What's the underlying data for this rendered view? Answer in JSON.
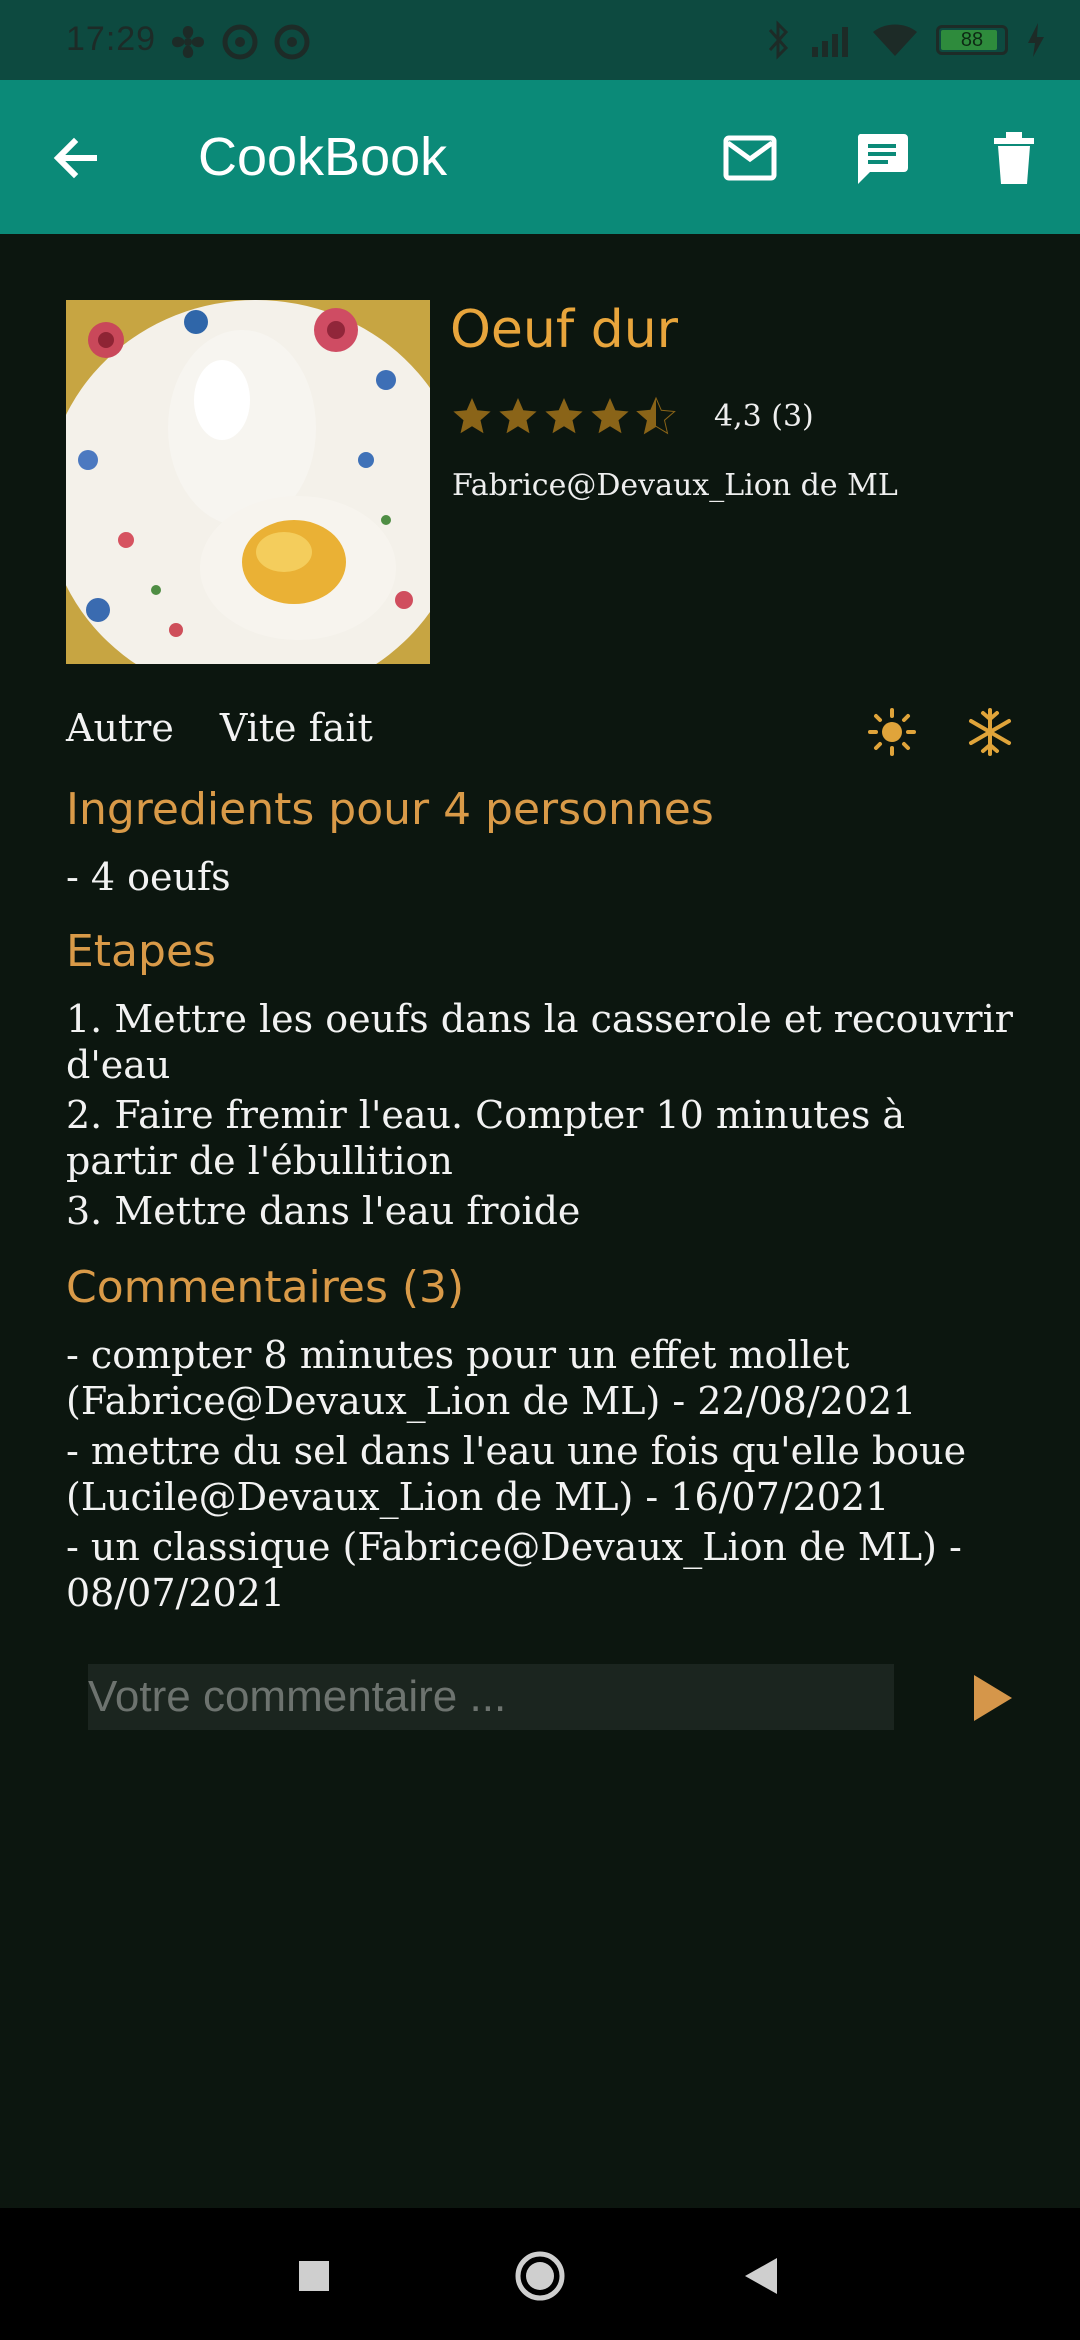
{
  "status_bar": {
    "time": "17:29",
    "battery": "88",
    "icons_left": [
      "fan-icon",
      "at-icon",
      "at-icon"
    ],
    "icons_right": [
      "bluetooth-icon",
      "signal-icon",
      "wifi-icon",
      "battery-icon",
      "charging-icon"
    ]
  },
  "app_bar": {
    "title": "CookBook",
    "actions": [
      "mail-icon",
      "message-icon",
      "delete-icon"
    ]
  },
  "recipe": {
    "title": "Oeuf dur",
    "rating_value": 4.3,
    "rating_text": "4,3  (3)",
    "author": "Fabrice@Devaux_Lion de ML",
    "tags": [
      "Autre",
      "Vite fait"
    ],
    "season_icons": [
      "sun-icon",
      "snowflake-icon"
    ]
  },
  "ingredients": {
    "title": "Ingredients pour 4 personnes",
    "items": [
      "- 4 oeufs"
    ]
  },
  "steps": {
    "title": "Etapes",
    "items": [
      "1. Mettre les oeufs dans la casserole et recouvrir d'eau",
      "2. Faire fremir l'eau. Compter 10 minutes  à partir de l'ébullition",
      "3. Mettre dans l'eau froide"
    ]
  },
  "comments": {
    "title": "Commentaires (3)",
    "items": [
      "- compter 8 minutes pour un effet mollet (Fabrice@Devaux_Lion de ML) - 22/08/2021",
      "- mettre du sel dans l'eau une fois qu'elle boue (Lucile@Devaux_Lion de ML) - 16/07/2021",
      "- un classique (Fabrice@Devaux_Lion de ML) - 08/07/2021"
    ],
    "input_placeholder": "Votre commentaire ...",
    "input_value": ""
  },
  "colors": {
    "accent": "#e8a53c",
    "app_bar": "#0b8a78",
    "status_bar": "#0d4a40",
    "background": "#0c160f"
  }
}
